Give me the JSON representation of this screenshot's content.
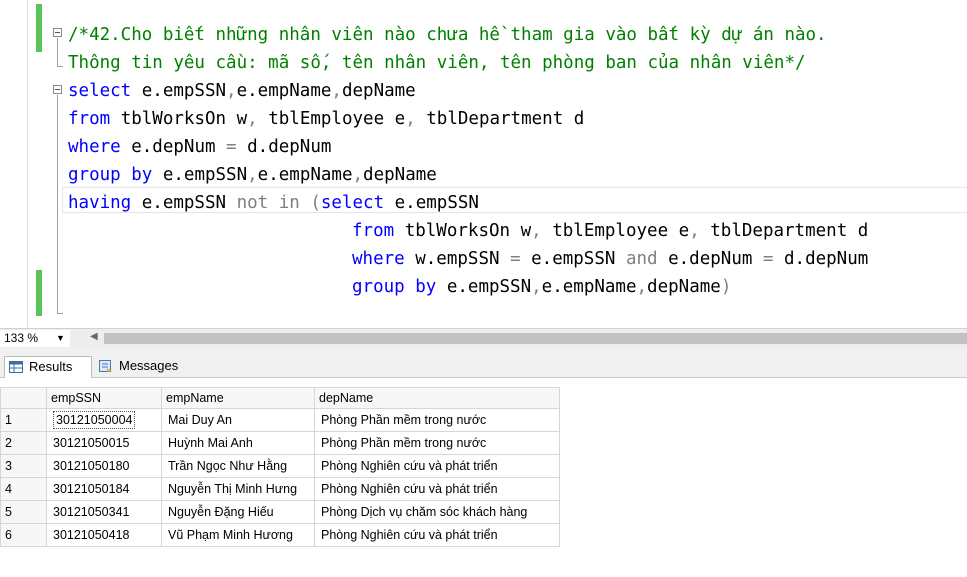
{
  "editor": {
    "lines": [
      {
        "segments": [
          {
            "t": "/*42.Cho biết những nhân viên nào chưa hề tham gia vào bất kỳ dự án nào.",
            "c": "cm"
          }
        ]
      },
      {
        "segments": [
          {
            "t": "Thông tin yêu cầu: mã số, tên nhân viên, tên phòng ban của nhân viên*/",
            "c": "cm"
          }
        ]
      },
      {
        "segments": [
          {
            "t": "select",
            "c": "kw"
          },
          {
            "t": " e.empSSN",
            "c": "bk"
          },
          {
            "t": ",",
            "c": "gr"
          },
          {
            "t": "e.empName",
            "c": "bk"
          },
          {
            "t": ",",
            "c": "gr"
          },
          {
            "t": "depName",
            "c": "bk"
          }
        ]
      },
      {
        "segments": [
          {
            "t": "from",
            "c": "kw"
          },
          {
            "t": " tblWorksOn w",
            "c": "bk"
          },
          {
            "t": ",",
            "c": "gr"
          },
          {
            "t": " tblEmployee e",
            "c": "bk"
          },
          {
            "t": ",",
            "c": "gr"
          },
          {
            "t": " tblDepartment d",
            "c": "bk"
          }
        ]
      },
      {
        "segments": [
          {
            "t": "where",
            "c": "kw"
          },
          {
            "t": " e.depNum ",
            "c": "bk"
          },
          {
            "t": "=",
            "c": "gr"
          },
          {
            "t": " d.depNum",
            "c": "bk"
          }
        ]
      },
      {
        "segments": [
          {
            "t": "group by",
            "c": "kw"
          },
          {
            "t": " e.empSSN",
            "c": "bk"
          },
          {
            "t": ",",
            "c": "gr"
          },
          {
            "t": "e.empName",
            "c": "bk"
          },
          {
            "t": ",",
            "c": "gr"
          },
          {
            "t": "depName",
            "c": "bk"
          }
        ]
      },
      {
        "segments": [
          {
            "t": "having",
            "c": "kw"
          },
          {
            "t": " e.empSSN ",
            "c": "bk"
          },
          {
            "t": "not in",
            "c": "gr"
          },
          {
            "t": " ",
            "c": "bk"
          },
          {
            "t": "(",
            "c": "gr"
          },
          {
            "t": "select",
            "c": "kw"
          },
          {
            "t": " e.empSSN",
            "c": "bk"
          }
        ]
      },
      {
        "segments": [
          {
            "t": "from",
            "c": "kw"
          },
          {
            "t": " tblWorksOn w",
            "c": "bk"
          },
          {
            "t": ",",
            "c": "gr"
          },
          {
            "t": " tblEmployee e",
            "c": "bk"
          },
          {
            "t": ",",
            "c": "gr"
          },
          {
            "t": " tblDepartment d",
            "c": "bk"
          }
        ]
      },
      {
        "segments": [
          {
            "t": "where",
            "c": "kw"
          },
          {
            "t": " w.empSSN ",
            "c": "bk"
          },
          {
            "t": "=",
            "c": "gr"
          },
          {
            "t": " e.empSSN ",
            "c": "bk"
          },
          {
            "t": "and",
            "c": "gr"
          },
          {
            "t": " e.depNum ",
            "c": "bk"
          },
          {
            "t": "=",
            "c": "gr"
          },
          {
            "t": " d.depNum",
            "c": "bk"
          }
        ]
      },
      {
        "segments": [
          {
            "t": "group by",
            "c": "kw"
          },
          {
            "t": " e.empSSN",
            "c": "bk"
          },
          {
            "t": ",",
            "c": "gr"
          },
          {
            "t": "e.empName",
            "c": "bk"
          },
          {
            "t": ",",
            "c": "gr"
          },
          {
            "t": "depName",
            "c": "bk"
          },
          {
            "t": ")",
            "c": "gr"
          }
        ]
      }
    ]
  },
  "zoom": {
    "value": "133 %"
  },
  "tabs": {
    "results": "Results",
    "messages": "Messages"
  },
  "grid": {
    "columns": [
      "empSSN",
      "empName",
      "depName"
    ],
    "rows": [
      {
        "num": "1",
        "empSSN": "30121050004",
        "empName": "Mai Duy An",
        "depName": "Phòng Phần mềm trong nước"
      },
      {
        "num": "2",
        "empSSN": "30121050015",
        "empName": "Huỳnh Mai Anh",
        "depName": "Phòng Phần mềm trong nước"
      },
      {
        "num": "3",
        "empSSN": "30121050180",
        "empName": "Trần Ngọc Như Hằng",
        "depName": "Phòng Nghiên cứu và phát triển"
      },
      {
        "num": "4",
        "empSSN": "30121050184",
        "empName": "Nguyễn Thị Minh Hưng",
        "depName": "Phòng Nghiên cứu và phát triển"
      },
      {
        "num": "5",
        "empSSN": "30121050341",
        "empName": "Nguyễn Đặng Hiếu",
        "depName": "Phòng Dịch vụ chăm sóc khách hàng"
      },
      {
        "num": "6",
        "empSSN": "30121050418",
        "empName": "Vũ Phạm Minh Hương",
        "depName": "Phòng Nghiên cứu và phát triển"
      }
    ]
  }
}
